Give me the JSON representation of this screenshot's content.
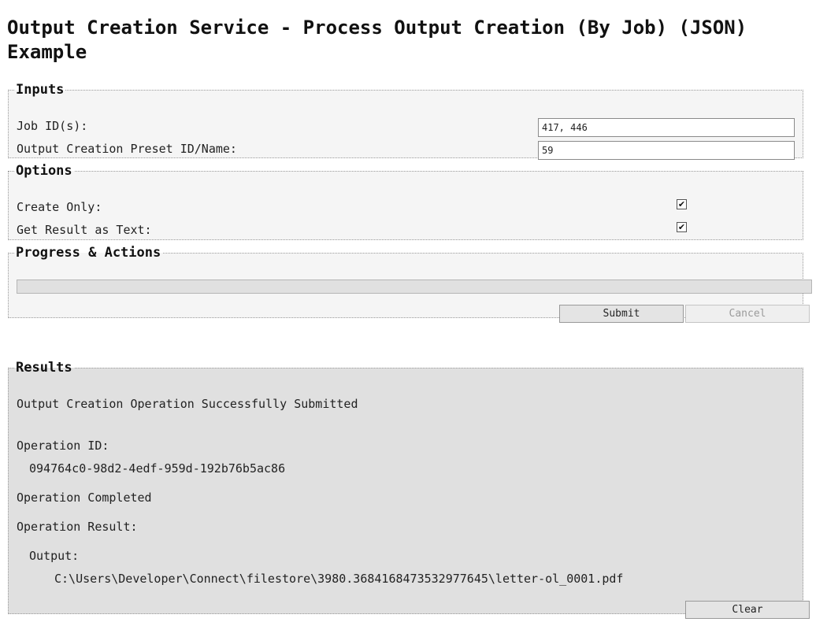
{
  "page": {
    "title": "Output Creation Service - Process Output Creation (By Job) (JSON) Example"
  },
  "inputs": {
    "legend": "Inputs",
    "job_ids_label": "Job ID(s):",
    "job_ids_value": "417, 446",
    "preset_label": "Output Creation Preset ID/Name:",
    "preset_value": "59"
  },
  "options": {
    "legend": "Options",
    "create_only_label": "Create Only:",
    "create_only_checked": true,
    "get_result_label": "Get Result as Text:",
    "get_result_checked": true,
    "check_glyph": "✔"
  },
  "progress": {
    "legend": "Progress & Actions",
    "percent": 0,
    "submit_label": "Submit",
    "cancel_label": "Cancel"
  },
  "results": {
    "legend": "Results",
    "status_line": "Output Creation Operation Successfully Submitted",
    "operation_id_label": "Operation ID:",
    "operation_id": "094764c0-98d2-4edf-959d-192b76b5ac86",
    "completed_line": "Operation Completed",
    "result_label": "Operation Result:",
    "output_label": "Output:",
    "output_path": "C:\\Users\\Developer\\Connect\\filestore\\3980.3684168473532977645\\letter-ol_0001.pdf",
    "clear_label": "Clear"
  },
  "colors": {
    "results_background": "#e0e0e0",
    "panel_background": "#f5f5f5"
  }
}
